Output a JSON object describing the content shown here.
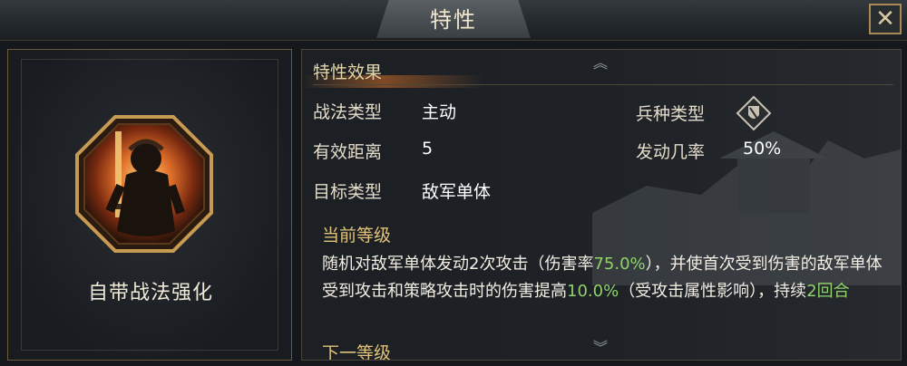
{
  "window": {
    "title": "特性"
  },
  "close_icon": "close-icon",
  "skill_card": {
    "name": "自带战法强化",
    "portrait_icon": "armored-warrior-portrait"
  },
  "details": {
    "section_title": "特性效果",
    "rows": [
      {
        "label": "战法类型",
        "value": "主动"
      },
      {
        "label": "有效距离",
        "value": "5"
      },
      {
        "label": "目标类型",
        "value": "敌军单体"
      }
    ],
    "right_rows": [
      {
        "label": "兵种类型",
        "icon": "troop-type-icon"
      },
      {
        "label": "发动几率",
        "value": "50%"
      }
    ],
    "current_level_title": "当前等级",
    "description": {
      "p1": "随机对敌军单体发动2次攻击（伤害率",
      "h1": "75.0%",
      "p2": "），并使首次受到伤害的敌军单体受到攻击和策略攻击时的伤害提高",
      "h2": "10.0%",
      "p3": "（受攻击属性影响），持续",
      "h3": "2回合"
    },
    "next_level_title": "下一等级"
  },
  "colors": {
    "highlight": "#8fd36a",
    "gold": "#e0c27a",
    "frame": "#a98a55"
  }
}
